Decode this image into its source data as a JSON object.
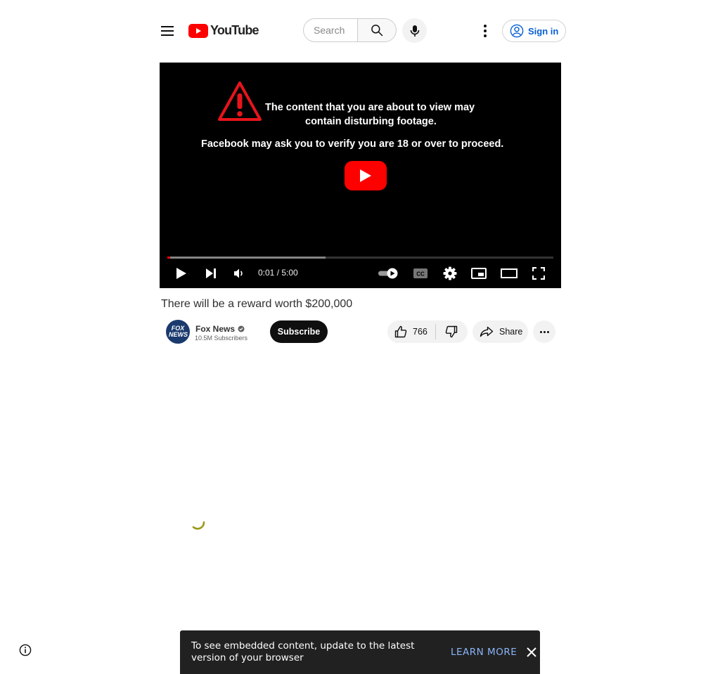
{
  "header": {
    "logo_text": "YouTube",
    "search_placeholder": "Search",
    "sign_in_label": "Sign in"
  },
  "player": {
    "warning_line1": "The content that you are about to view may",
    "warning_line2": "contain disturbing footage.",
    "warning_line3": "Facebook may ask you to verify you are 18 or over to proceed.",
    "time_display": "0:01 / 5:00",
    "progress_played_fraction": 0.003,
    "progress_loaded_fraction": 0.41
  },
  "video": {
    "title": "There will be a reward worth $200,000"
  },
  "channel": {
    "avatar_text": "FOX NEWS",
    "name": "Fox News",
    "subscribers": "10.5M Subscribers",
    "subscribe_label": "Subscribe"
  },
  "actions": {
    "like_count": "766",
    "share_label": "Share"
  },
  "toast": {
    "message": "To see embedded content, update to the latest version of your browser",
    "learn_more_label": "LEARN MORE"
  },
  "colors": {
    "brand_red": "#ff0000",
    "link_blue": "#065fd4",
    "toast_link": "#8ab4f8"
  }
}
